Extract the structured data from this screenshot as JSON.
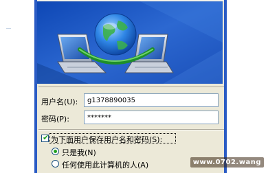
{
  "form": {
    "username_label": "用户名(U):",
    "username_value": "g1378890035",
    "password_label": "密码(P):",
    "password_value": "*******",
    "save_label": "为下面用户保存用户名和密码(S):",
    "save_checked": true,
    "options": [
      {
        "label": "只是我(N)",
        "selected": true
      },
      {
        "label": "任何使用此计算机的人(A)",
        "selected": false
      }
    ]
  },
  "watermark": "www.0702.wang",
  "colors": {
    "dialog_bg": "#ece9d8",
    "frame_blue": "#2a5bc4",
    "banner_dark": "#0b3f9e",
    "check_green": "#21a121"
  },
  "icons": {
    "banner": "network-connection-globe-laptops"
  }
}
